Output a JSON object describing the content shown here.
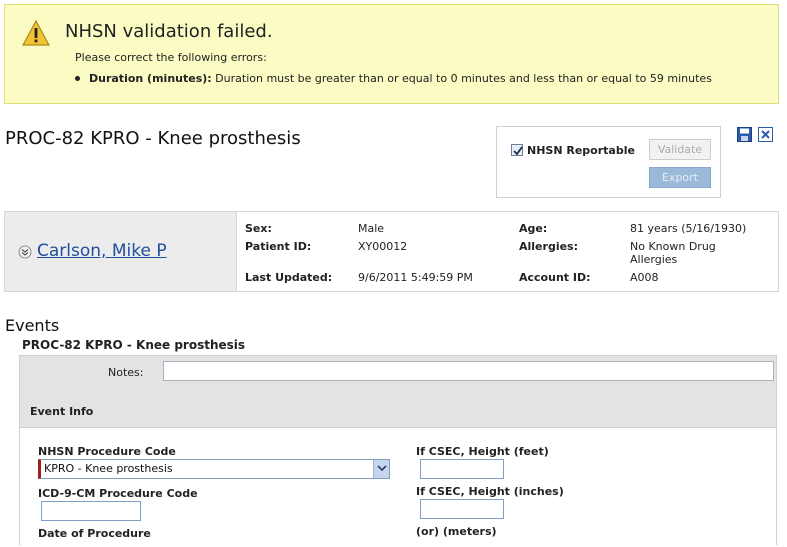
{
  "banner": {
    "title": "NHSN validation failed.",
    "subtitle": "Please correct the following errors:",
    "error_field": "Duration (minutes):",
    "error_message": "Duration must be greater than or equal to 0 minutes and less than or equal to 59 minutes",
    "icon": "warning-icon"
  },
  "procedure": {
    "title": "PROC-82 KPRO - Knee prosthesis"
  },
  "nhsn": {
    "reportable_label": "NHSN Reportable",
    "reportable_checked": true,
    "validate_label": "Validate",
    "export_label": "Export"
  },
  "toolbar": {
    "save_icon": "save-icon",
    "close_icon": "close-icon"
  },
  "patient": {
    "name": "Carlson, Mike P",
    "sex_label": "Sex:",
    "sex": "Male",
    "patient_id_label": "Patient ID:",
    "patient_id": "XY00012",
    "last_updated_label": "Last Updated:",
    "last_updated": "9/6/2011 5:49:59 PM",
    "age_label": "Age:",
    "age": "81 years (5/16/1930)",
    "allergies_label": "Allergies:",
    "allergies_line1": "No Known Drug",
    "allergies_line2": "Allergies",
    "account_id_label": "Account ID:",
    "account_id": "A008"
  },
  "events": {
    "heading": "Events",
    "procedure_heading": "PROC-82 KPRO - Knee prosthesis",
    "notes_label": "Notes:",
    "notes_value": "",
    "event_info_heading": "Event Info",
    "fields": {
      "nhsn_code_label": "NHSN Procedure Code",
      "nhsn_code_value": "KPRO - Knee prosthesis",
      "icd9_label": "ICD-9-CM Procedure Code",
      "icd9_value": "",
      "date_label": "Date of Procedure",
      "height_feet_label": "If CSEC, Height (feet)",
      "height_feet_value": "",
      "height_inches_label": "If CSEC, Height (inches)",
      "height_inches_value": "",
      "meters_label": "(or) (meters)"
    }
  },
  "colors": {
    "banner_bg": "#fbfbc4",
    "link": "#1f4e9c",
    "required_marker": "#a0201e",
    "export_button": "#9ab8d8"
  }
}
